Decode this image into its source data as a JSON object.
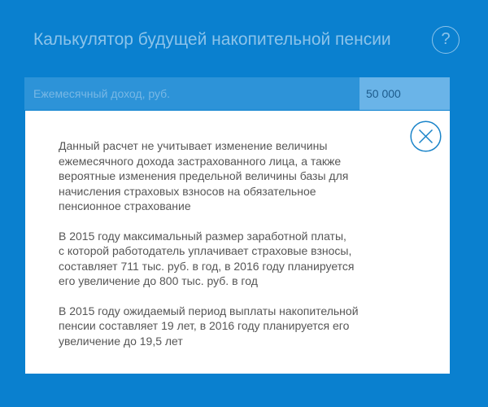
{
  "header": {
    "title": "Калькулятор будущей накопительной пенсии",
    "help_label": "?"
  },
  "income": {
    "label": "Ежемесячный доход, руб.",
    "value": "50 000"
  },
  "modal": {
    "close_icon": "close-x-circle-icon",
    "paragraphs": [
      {
        "lines": [
          "Данный расчет не учитывает изменение величины",
          "ежемесячного дохода застрахованного лица, а также",
          "вероятные изменения предельной величины базы для",
          "начисления страховых взносов на обязательное",
          "пенсионное страхование"
        ]
      },
      {
        "lines": [
          "В 2015 году максимальный размер заработной платы,",
          "с которой работодатель уплачивает страховые взносы,",
          "составляет 711 тыс. руб. в год, в 2016 году планируется",
          "его увеличение до 800 тыс. руб. в год"
        ]
      },
      {
        "lines": [
          "В 2015 году ожидаемый период выплаты накопительной",
          "пенсии составляет 19 лет, в 2016 году планируется его",
          "увеличение до 19,5 лет"
        ]
      }
    ]
  },
  "colors": {
    "background": "#0a80cf",
    "title": "#8cc3ea",
    "input_row": "#2d93d8",
    "input_value_bg": "#6ab4e8",
    "close_icon": "#1a84c9",
    "body_text": "#565656"
  }
}
